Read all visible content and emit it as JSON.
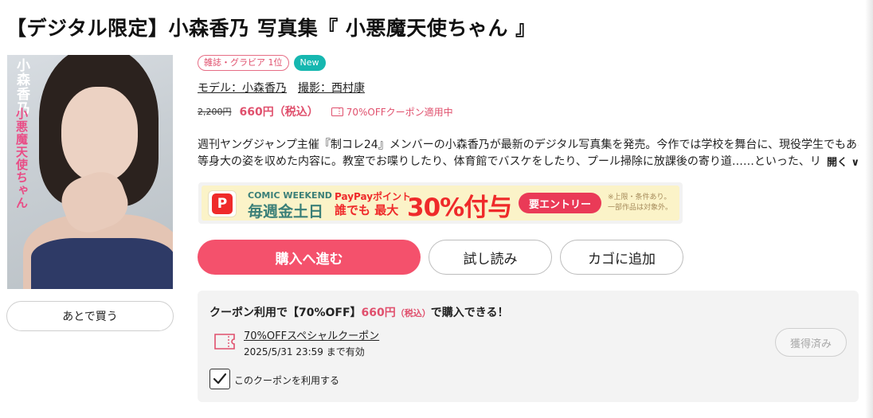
{
  "title": "【デジタル限定】小森香乃 写真集『 小悪魔天使ちゃん 』",
  "cover": {
    "name_vertical": "小森香乃",
    "subtitle_vertical": "小悪魔天使ちゃん"
  },
  "tags": {
    "rank": "雑誌・グラビア 1位",
    "new": "New"
  },
  "credits": {
    "model": "モデル：小森香乃",
    "photographer": "撮影：西村康"
  },
  "price": {
    "original": "2,200円",
    "discounted": "660円（税込）",
    "coupon_note": "70%OFFクーポン適用中"
  },
  "description": {
    "line1": "週刊ヤングジャンプ主催『制コレ24』メンバーの小森香乃が最新のデジタル写真集を発売。今作では学校を舞台に、現役学生でもある小森の",
    "line2": "等身大の姿を収めた内容に。教室でお喋りしたり、体育館でバスケをしたり、プール掃除に放課後の寄り道……といった、リアルな学生",
    "toggle": "開く ∨"
  },
  "banner": {
    "logo": "P",
    "line_a": "COMIC WEEKEND",
    "line_b": "毎週金土日",
    "pp_a": "PayPayポイント",
    "pp_b": "誰でも 最大",
    "big": "30%付与",
    "entry": "要エントリー",
    "fine1": "※上限・条件あり。",
    "fine2": "一部作品は対象外。"
  },
  "actions": {
    "buy": "購入へ進む",
    "sample": "試し読み",
    "cart": "カゴに追加",
    "later": "あとで買う"
  },
  "coupon_box": {
    "head_a": "クーポン利用で【70%OFF】",
    "head_price": "660円",
    "head_tax": "（税込）",
    "head_b": "で購入できる！",
    "coupon_name": "70%OFFスペシャルクーポン",
    "expiry": "2025/5/31 23:59 まで有効",
    "acquired": "獲得済み",
    "checkbox_label": "このクーポンを利用する"
  },
  "colors": {
    "accent": "#f4516c",
    "pink_text": "#e0506d",
    "new_badge": "#16b7b0"
  }
}
